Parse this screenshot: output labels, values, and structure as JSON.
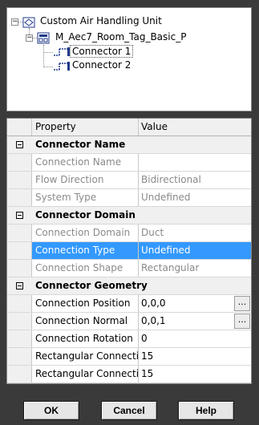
{
  "tree": {
    "root_label": "Custom Air Handling Unit",
    "child_label": "M_Aec7_Room_Tag_Basic_P",
    "connectors": [
      "Connector 1",
      "Connector 2"
    ],
    "expand_symbol": "−"
  },
  "grid": {
    "header_property": "Property",
    "header_value": "Value",
    "rows": [
      {
        "kind": "cat",
        "name": "Connector Name"
      },
      {
        "kind": "prop",
        "name": "Connection Name",
        "value": "",
        "disabled": true
      },
      {
        "kind": "prop",
        "name": "Flow Direction",
        "value": "Bidirectional",
        "disabled": true
      },
      {
        "kind": "prop",
        "name": "System Type",
        "value": "Undefined",
        "disabled": true
      },
      {
        "kind": "cat",
        "name": "Connector Domain"
      },
      {
        "kind": "prop",
        "name": "Connection Domain",
        "value": "Duct",
        "disabled": true
      },
      {
        "kind": "prop",
        "name": "Connection Type",
        "value": "Undefined",
        "selected": true
      },
      {
        "kind": "prop",
        "name": "Connection Shape",
        "value": "Rectangular",
        "disabled": true
      },
      {
        "kind": "cat",
        "name": "Connector Geometry"
      },
      {
        "kind": "prop",
        "name": "Connection Position",
        "value": "0,0,0",
        "ellipsis": "..."
      },
      {
        "kind": "prop",
        "name": "Connection Normal",
        "value": "0,0,1",
        "ellipsis": "..."
      },
      {
        "kind": "prop",
        "name": "Connection Rotation",
        "value": "0"
      },
      {
        "kind": "prop",
        "name": "Rectangular Connecti...",
        "value": "15"
      },
      {
        "kind": "prop",
        "name": "Rectangular Connecti...",
        "value": "15"
      }
    ]
  },
  "buttons": {
    "ok": "OK",
    "cancel": "Cancel",
    "help": "Help"
  },
  "colors": {
    "selection": "#3399ff",
    "disabled_text": "#8a8a8a",
    "background": "#3a3a3a"
  }
}
